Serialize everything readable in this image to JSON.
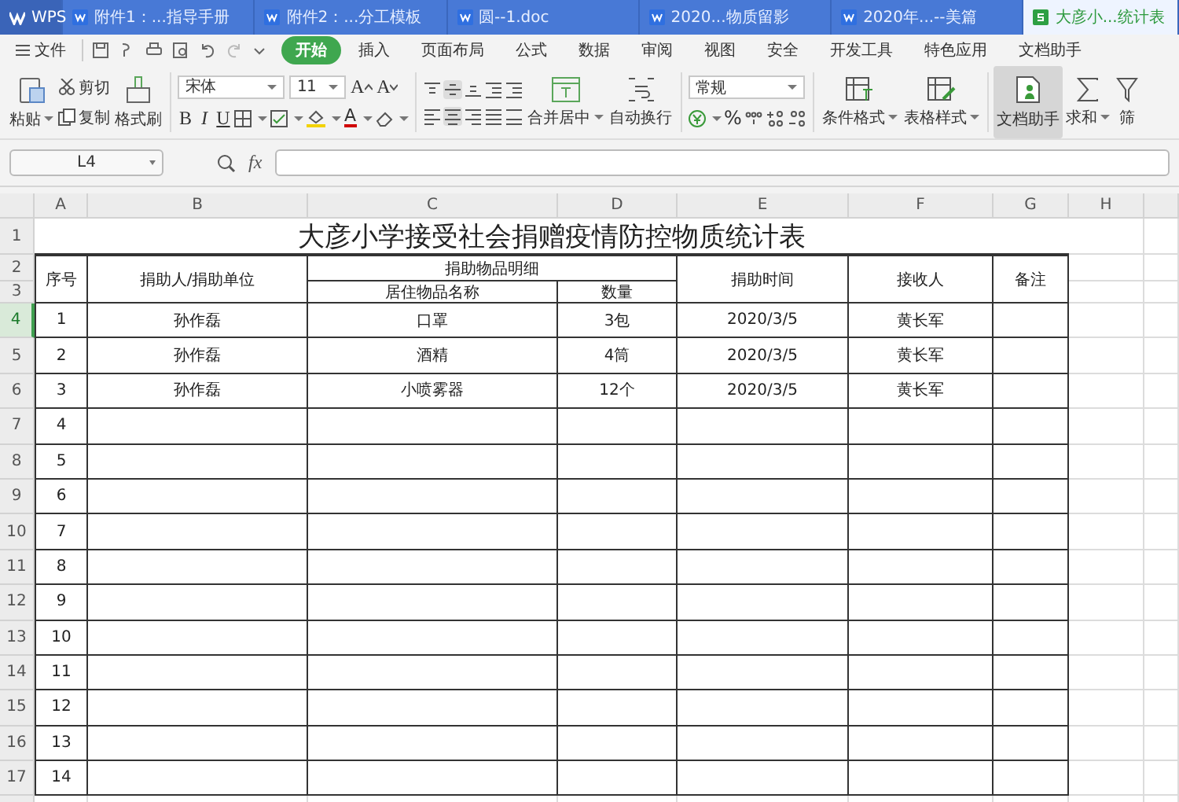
{
  "app_tabs": [
    {
      "label": "WPS",
      "kind": "home",
      "selected": false
    },
    {
      "label": "附件1：...指导手册",
      "kind": "writer",
      "selected": false
    },
    {
      "label": "附件2：...分工模板",
      "kind": "writer",
      "selected": false
    },
    {
      "label": "圆--1.doc",
      "kind": "writer",
      "selected": false
    },
    {
      "label": "2020...物质留影",
      "kind": "writer",
      "selected": false
    },
    {
      "label": "2020年...--美篇",
      "kind": "writer",
      "selected": false
    },
    {
      "label": "大彦小...统计表",
      "kind": "sheet",
      "selected": true
    }
  ],
  "menu": {
    "file": "文件",
    "items": [
      {
        "label": "开始",
        "selected": true
      },
      {
        "label": "插入",
        "selected": false
      },
      {
        "label": "页面布局",
        "selected": false
      },
      {
        "label": "公式",
        "selected": false
      },
      {
        "label": "数据",
        "selected": false
      },
      {
        "label": "审阅",
        "selected": false
      },
      {
        "label": "视图",
        "selected": false
      },
      {
        "label": "安全",
        "selected": false
      },
      {
        "label": "开发工具",
        "selected": false
      },
      {
        "label": "特色应用",
        "selected": false
      },
      {
        "label": "文档助手",
        "selected": false
      }
    ]
  },
  "ribbon": {
    "paste": "粘贴",
    "cut": "剪切",
    "copy": "复制",
    "format_painter": "格式刷",
    "font": "宋体",
    "font_size": "11",
    "grow_font": "A",
    "shrink_font": "A",
    "bold": "B",
    "italic": "I",
    "underline": "U",
    "font_color": "A",
    "merge": "合并居中",
    "wrap": "自动换行",
    "number_format": "常规",
    "percent": "%",
    "conditional_format": "条件格式",
    "table_style": "表格样式",
    "doc_assistant": {
      "label": "文档助手",
      "selected": true
    },
    "sum": "求和",
    "filter": "筛"
  },
  "formula_bar": {
    "cell_ref": "L4",
    "fx": "fx"
  },
  "sheet": {
    "columns": [
      "A",
      "B",
      "C",
      "D",
      "E",
      "F",
      "G",
      "H"
    ],
    "row_numbers": [
      {
        "label": "1",
        "selected": false
      },
      {
        "label": "2",
        "selected": false
      },
      {
        "label": "3",
        "selected": false
      },
      {
        "label": "4",
        "selected": true
      },
      {
        "label": "5",
        "selected": false
      },
      {
        "label": "6",
        "selected": false
      },
      {
        "label": "7",
        "selected": false
      },
      {
        "label": "8",
        "selected": false
      },
      {
        "label": "9",
        "selected": false
      },
      {
        "label": "10",
        "selected": false
      },
      {
        "label": "11",
        "selected": false
      },
      {
        "label": "12",
        "selected": false
      },
      {
        "label": "13",
        "selected": false
      },
      {
        "label": "14",
        "selected": false
      },
      {
        "label": "15",
        "selected": false
      },
      {
        "label": "16",
        "selected": false
      },
      {
        "label": "17",
        "selected": false
      }
    ],
    "title": "大彦小学接受社会捐赠疫情防控物质统计表",
    "header": {
      "seq": "序号",
      "donor": "捐助人/捐助单位",
      "items_group": "捐助物品明细",
      "item_name": "居住物品名称",
      "quantity": "数量",
      "time": "捐助时间",
      "receiver": "接收人",
      "note": "备注"
    },
    "rows": [
      {
        "cells": [
          "1",
          "孙作磊",
          "口罩",
          "3包",
          "2020/3/5",
          "黄长军"
        ]
      },
      {
        "cells": [
          "2",
          "孙作磊",
          "酒精",
          "4筒",
          "2020/3/5",
          "黄长军"
        ]
      },
      {
        "cells": [
          "3",
          "孙作磊",
          "小喷雾器",
          "12个",
          "2020/3/5",
          "黄长军"
        ]
      },
      {
        "cells": [
          "4"
        ]
      },
      {
        "cells": [
          "5"
        ]
      },
      {
        "cells": [
          "6"
        ]
      },
      {
        "cells": [
          "7"
        ]
      },
      {
        "cells": [
          "8"
        ]
      },
      {
        "cells": [
          "9"
        ]
      },
      {
        "cells": [
          "10"
        ]
      },
      {
        "cells": [
          "11"
        ]
      },
      {
        "cells": [
          "12"
        ]
      },
      {
        "cells": [
          "13"
        ]
      },
      {
        "cells": [
          "14"
        ]
      }
    ]
  }
}
